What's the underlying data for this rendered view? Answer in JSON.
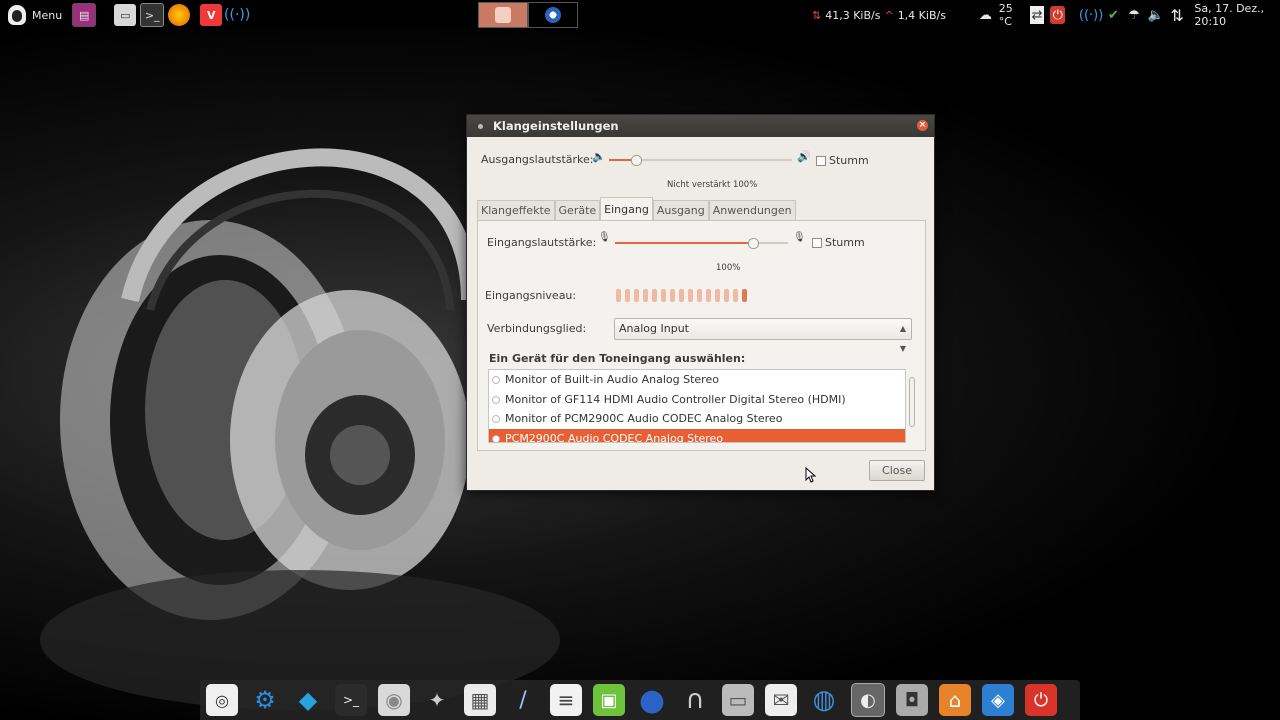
{
  "top_panel": {
    "menu_label": "Menu",
    "launchers": [
      {
        "name": "Dateimanager",
        "icon": "window-icon",
        "color": "#9b2f7b"
      },
      {
        "name": "Dateien",
        "icon": "file-manager-icon",
        "color": "#d8d8d8"
      },
      {
        "name": "Terminal",
        "icon": "terminal-icon",
        "color": "#333333"
      },
      {
        "name": "Firefox",
        "icon": "firefox-icon",
        "color": "#e66000"
      },
      {
        "name": "Vivaldi",
        "icon": "vivaldi-icon",
        "color": "#ef3939"
      },
      {
        "name": "Netzwerk",
        "icon": "wireless-icon",
        "color": "#3b9ddd"
      }
    ],
    "network": {
      "down": "41,3 KiB/s",
      "up": "1,4 KiB/s"
    },
    "temperature": "25 °C",
    "clock": "Sa, 17. Dez., 20:10"
  },
  "dialog": {
    "title": "Klangeinstellungen",
    "output_volume_label": "Ausgangslautstärke:",
    "output_volume_value": 0.15,
    "output_mute_label": "Stumm",
    "output_volume_caption": "Nicht verstärkt 100%",
    "tabs": [
      "Klangeffekte",
      "Geräte",
      "Eingang",
      "Ausgang",
      "Anwendungen"
    ],
    "active_tab": "Eingang",
    "input_volume_label": "Eingangslautstärke:",
    "input_volume_value": 0.8,
    "input_mute_label": "Stumm",
    "input_volume_caption": "100%",
    "input_level_label": "Eingangsniveau:",
    "input_level_bars": 15,
    "input_level_active": 1,
    "connector_label": "Verbindungsglied:",
    "connector_value": "Analog Input",
    "device_section_title": "Ein Gerät für den Toneingang auswählen:",
    "devices": [
      "Monitor of Built-in Audio Analog Stereo",
      "Monitor of GF114 HDMI Audio Controller Digital Stereo (HDMI)",
      "Monitor of PCM2900C Audio CODEC Analog Stereo",
      "PCM2900C Audio CODEC Analog Stereo"
    ],
    "selected_device_index": 3,
    "close_label": "Close",
    "accent_color": "#e95f34"
  },
  "dock": {
    "items": [
      {
        "name": "Ubuntu",
        "icon": "ubuntu-icon"
      },
      {
        "name": "Einstellungen",
        "icon": "settings-gear-icon"
      },
      {
        "name": "Kodi",
        "icon": "kodi-icon"
      },
      {
        "name": "Terminal",
        "icon": "terminal-icon"
      },
      {
        "name": "Disk",
        "icon": "optical-disc-icon"
      },
      {
        "name": "GIMP",
        "icon": "gimp-icon"
      },
      {
        "name": "Rechner",
        "icon": "calculator-icon"
      },
      {
        "name": "Stift",
        "icon": "pen-icon"
      },
      {
        "name": "Texteditor",
        "icon": "text-editor-icon"
      },
      {
        "name": "Archiv",
        "icon": "archive-icon"
      },
      {
        "name": "Google Earth",
        "icon": "google-earth-icon"
      },
      {
        "name": "Kopfhörer",
        "icon": "headphones-icon"
      },
      {
        "name": "Radio",
        "icon": "radio-icon"
      },
      {
        "name": "Mail",
        "icon": "mail-icon"
      },
      {
        "name": "Globus",
        "icon": "globe-icon"
      },
      {
        "name": "Audio",
        "icon": "audio-app-icon"
      },
      {
        "name": "Kamera",
        "icon": "camera-icon"
      },
      {
        "name": "Home",
        "icon": "home-folder-icon"
      },
      {
        "name": "Dropbox",
        "icon": "dropbox-icon"
      },
      {
        "name": "Ausschalten",
        "icon": "power-icon"
      }
    ]
  }
}
